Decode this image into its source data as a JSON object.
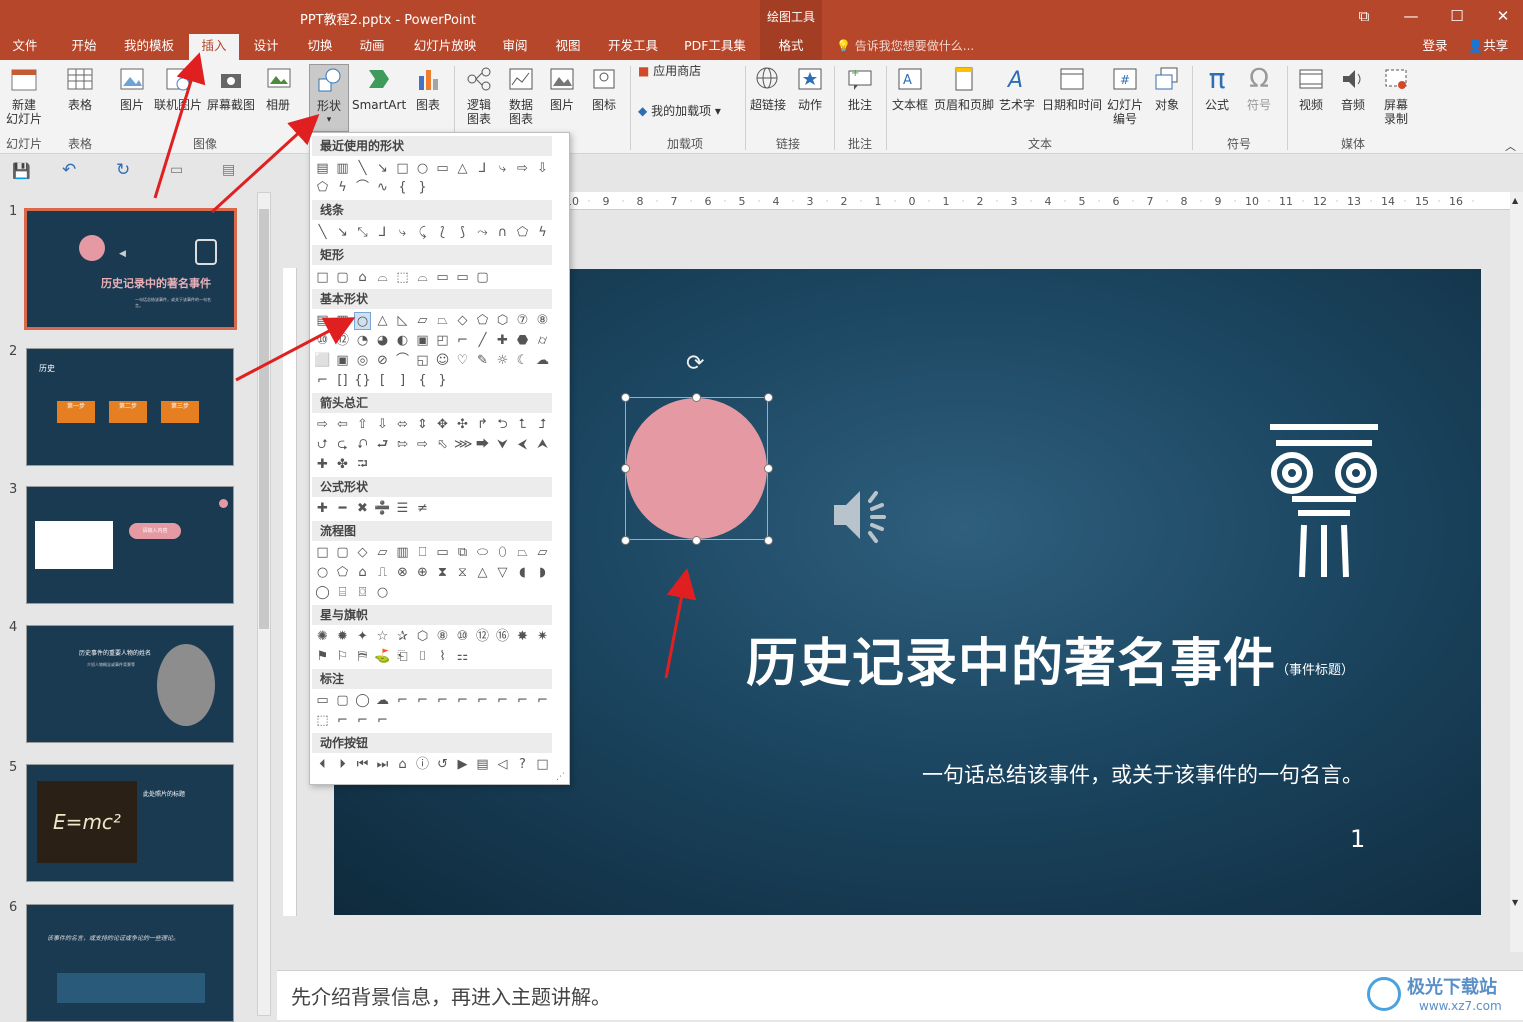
{
  "window": {
    "title": "PPT教程2.pptx - PowerPoint",
    "context_group": "绘图工具",
    "ribbon_display_icon": "ribbon-display-icon",
    "minimize": "—",
    "maximize": "☐",
    "close": "✕"
  },
  "tabs": [
    "文件",
    "开始",
    "我的模板",
    "插入",
    "设计",
    "切换",
    "动画",
    "幻灯片放映",
    "审阅",
    "视图",
    "开发工具",
    "PDF工具集",
    "格式"
  ],
  "tellme": "告诉我您想要做什么...",
  "account": {
    "signin": "登录",
    "share": "共享"
  },
  "ribbon": {
    "buttons": [
      "新建\n幻灯片",
      "表格",
      "图片",
      "联机图片",
      "屏幕截图",
      "相册",
      "形状",
      "SmartArt",
      "图表",
      "逻辑\n图表",
      "数据\n图表",
      "图片",
      "图标",
      "超链接",
      "动作",
      "批注",
      "文本框",
      "页眉和页脚",
      "艺术字",
      "日期和时间",
      "幻灯片\n编号",
      "对象",
      "公式",
      "符号",
      "视频",
      "音频",
      "屏幕\n录制"
    ],
    "addins": {
      "store": "应用商店",
      "my_addins": "我的加载项"
    },
    "groups": [
      "幻灯片",
      "表格",
      "图像",
      "加载项",
      "链接",
      "批注",
      "文本",
      "符号",
      "媒体"
    ]
  },
  "shapes_panel": {
    "sections": [
      "最近使用的形状",
      "线条",
      "矩形",
      "基本形状",
      "箭头总汇",
      "公式形状",
      "流程图",
      "星与旗帜",
      "标注",
      "动作按钮"
    ]
  },
  "thumbnails": [
    {
      "num": "1",
      "title": "历史记录中的著名事件",
      "sub": "一句话总结该事件，或关于该事件的一句名言。"
    },
    {
      "num": "2",
      "title": "历史",
      "steps": [
        "第一步",
        "第二步",
        "第三步"
      ]
    },
    {
      "num": "3",
      "bubble": "请输入内容"
    },
    {
      "num": "4",
      "title": "历史事件的重要人物的姓名",
      "sub": "介绍人物概念或事件背景等"
    },
    {
      "num": "5",
      "title": "此处照片的标题",
      "formula": "E=mc²"
    },
    {
      "num": "6",
      "quote": "该事件的名言，或支持的论证或争论的一些理论。"
    }
  ],
  "slide": {
    "title": "历史记录中的著名事件",
    "title_note": "（事件标题）",
    "subtitle": "一句话总结该事件，或关于该事件的一句名言。",
    "page_number": "1",
    "circle_color": "#e59aa3"
  },
  "notes": "先介绍背景信息，再进入主题讲解。",
  "watermark": {
    "site": "极光下载站",
    "url": "www.xz7.com"
  }
}
